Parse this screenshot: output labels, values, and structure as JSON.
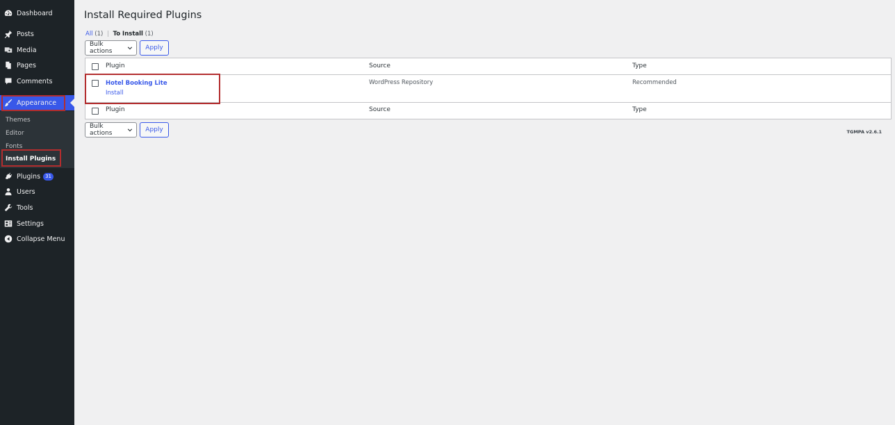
{
  "sidebar": {
    "items": [
      {
        "label": "Dashboard",
        "icon": "dashboard-icon"
      },
      {
        "label": "Posts",
        "icon": "pushpin-icon"
      },
      {
        "label": "Media",
        "icon": "media-icon"
      },
      {
        "label": "Pages",
        "icon": "pages-icon"
      },
      {
        "label": "Comments",
        "icon": "comments-icon"
      },
      {
        "label": "Appearance",
        "icon": "paintbrush-icon"
      },
      {
        "label": "Plugins",
        "icon": "plugin-icon",
        "badge": "31"
      },
      {
        "label": "Users",
        "icon": "user-icon"
      },
      {
        "label": "Tools",
        "icon": "wrench-icon"
      },
      {
        "label": "Settings",
        "icon": "settings-icon"
      },
      {
        "label": "Collapse Menu",
        "icon": "collapse-icon"
      }
    ],
    "submenu": [
      "Themes",
      "Editor",
      "Fonts",
      "Install Plugins"
    ]
  },
  "page": {
    "title": "Install Required Plugins",
    "filters": {
      "all_label": "All",
      "all_count": "(1)",
      "separator": "|",
      "to_install_label": "To Install",
      "to_install_count": "(1)"
    },
    "bulk_actions_label": "Bulk actions",
    "apply_label": "Apply"
  },
  "table": {
    "columns": [
      "Plugin",
      "Source",
      "Type"
    ],
    "rows": [
      {
        "plugin": "Hotel Booking Lite",
        "action": "Install",
        "source": "WordPress Repository",
        "type": "Recommended"
      }
    ]
  },
  "footer": {
    "version": "TGMPA v2.6.1"
  },
  "colors": {
    "accent": "#3858e9",
    "highlight": "#b32d2e",
    "sidebar_bg": "#1d2327"
  }
}
